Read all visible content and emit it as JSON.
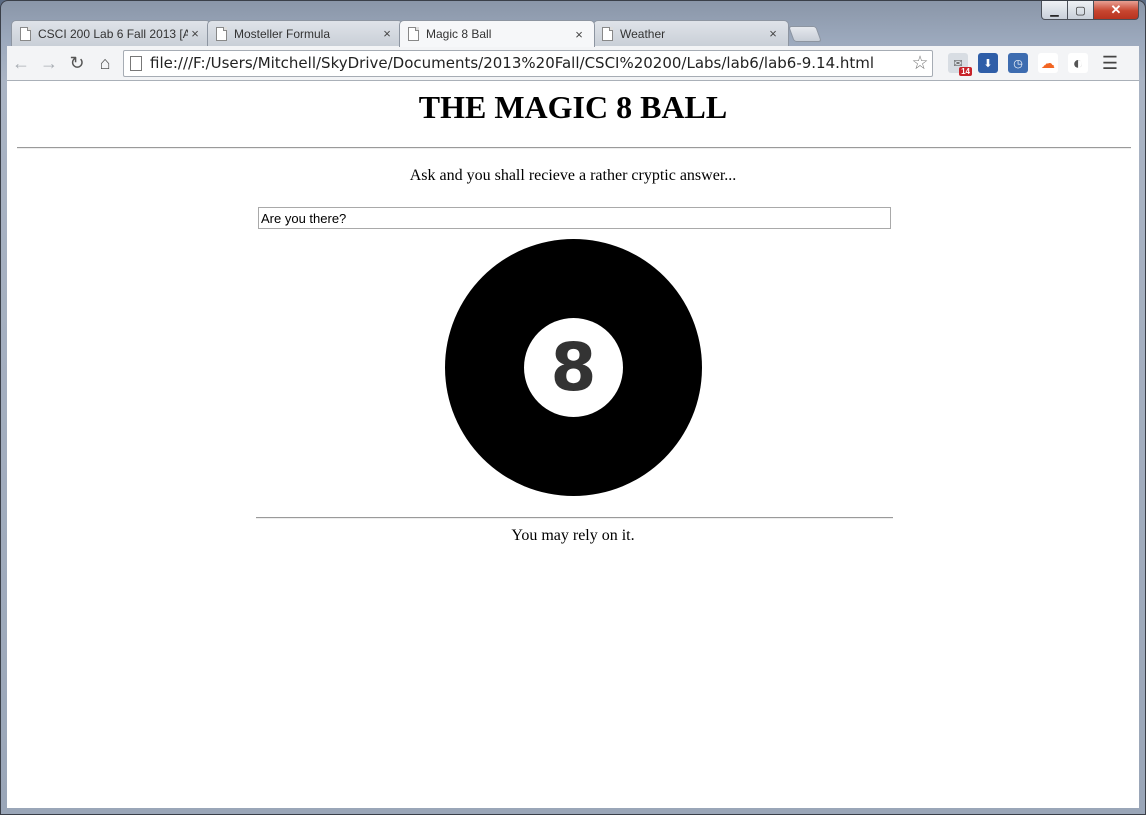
{
  "browser": {
    "tabs": [
      {
        "title": "CSCI 200 Lab 6 Fall 2013 [A",
        "active": false
      },
      {
        "title": "Mosteller Formula",
        "active": false
      },
      {
        "title": "Magic 8 Ball",
        "active": true
      },
      {
        "title": "Weather",
        "active": false
      }
    ],
    "tab_close_glyph": "×",
    "url": "file:///F:/Users/Mitchell/SkyDrive/Documents/2013%20Fall/CSCI%20200/Labs/lab6/lab6-9.14.html",
    "extensions": {
      "mail_badge": "14",
      "cloud_label": "☁"
    },
    "caption": {
      "minimize": "▁",
      "maximize": "▢",
      "close": "✕"
    }
  },
  "page": {
    "title": "THE MAGIC 8 BALL",
    "subtitle": "Ask and you shall recieve a rather cryptic answer...",
    "question_value": "Are you there?",
    "ball_number": "8",
    "answer": "You may rely on it."
  },
  "colors": {
    "ball": "#000000",
    "number": "#333333"
  }
}
